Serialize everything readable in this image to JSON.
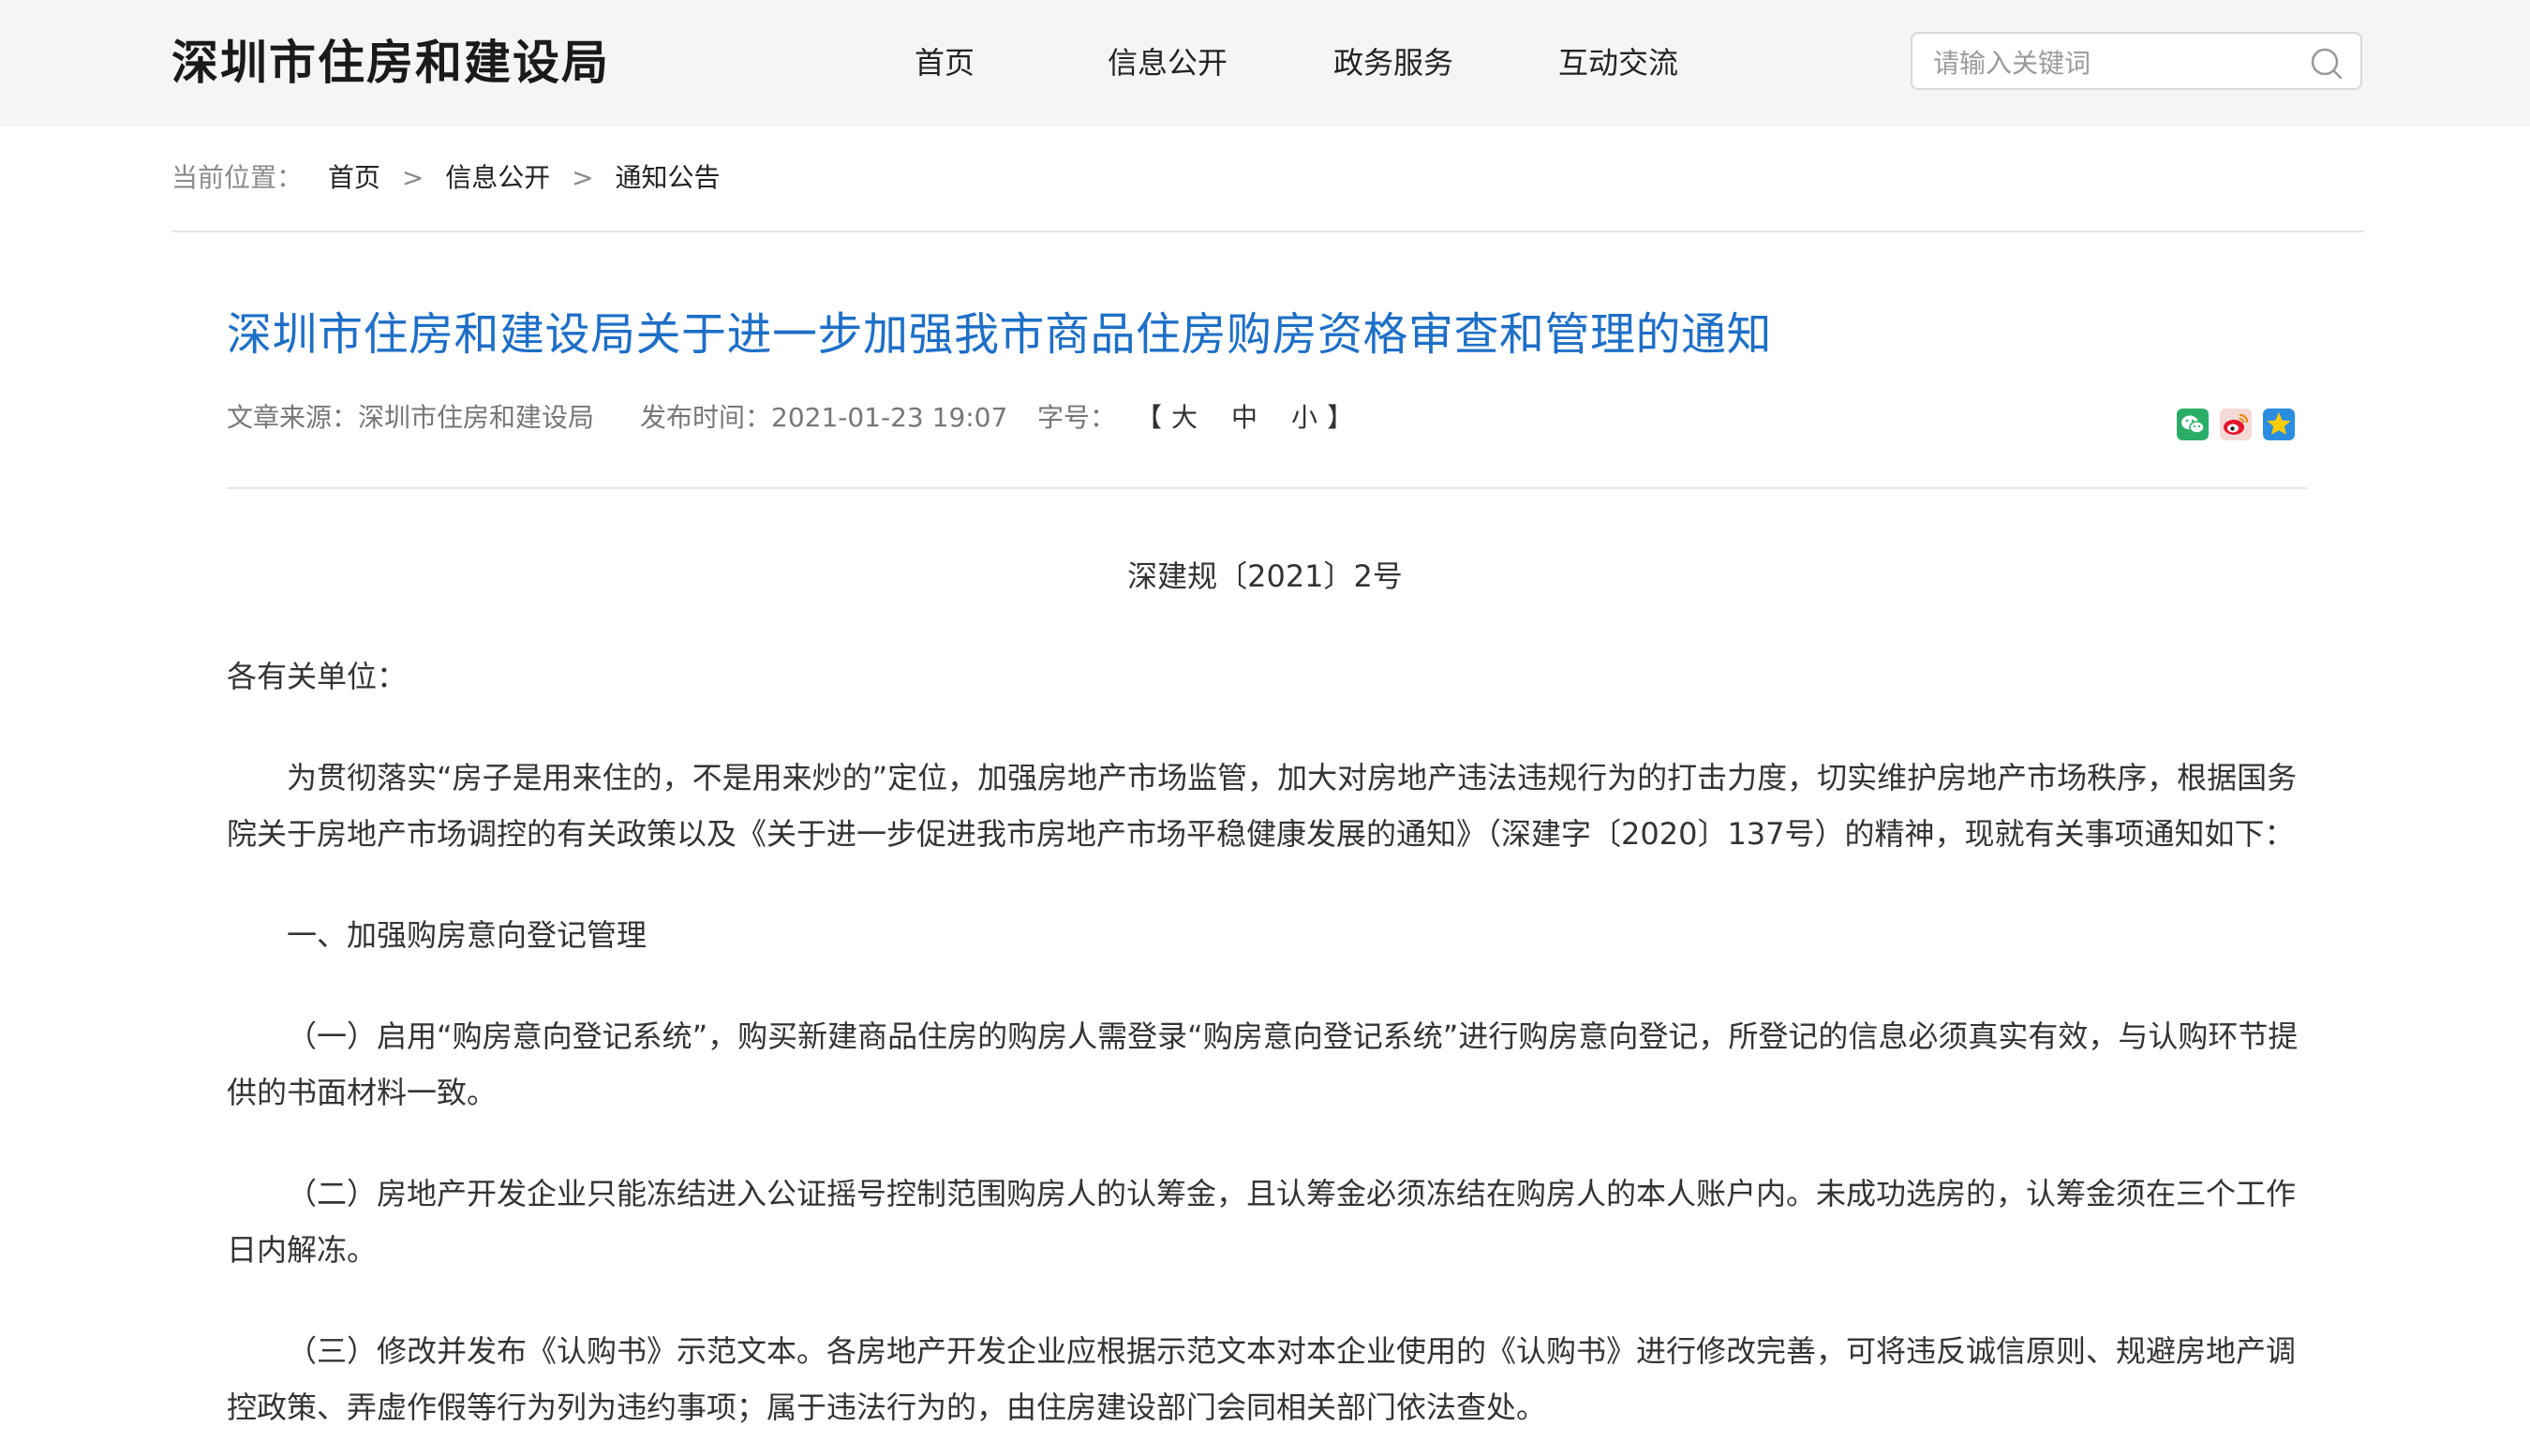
{
  "header": {
    "site_title": "深圳市住房和建设局",
    "nav": [
      "首页",
      "信息公开",
      "政务服务",
      "互动交流"
    ],
    "search": {
      "placeholder": "请输入关键词"
    }
  },
  "breadcrumb": {
    "label": "当前位置：",
    "items": [
      "首页",
      "信息公开",
      "通知公告"
    ],
    "separator": ">"
  },
  "article": {
    "title": "深圳市住房和建设局关于进一步加强我市商品住房购房资格审查和管理的通知",
    "source": "文章来源：深圳市住房和建设局",
    "publish_time": "发布时间：2021-01-23 19:07",
    "font_size_label": "字号：",
    "font_size": {
      "open": "【",
      "large": "大",
      "medium": "中",
      "small": "小",
      "close": "】"
    },
    "share_icons": [
      "wechat-icon",
      "weibo-icon",
      "qzone-icon"
    ],
    "doc_number": "深建规〔2021〕2号",
    "paragraphs": [
      "各有关单位：",
      "为贯彻落实“房子是用来住的，不是用来炒的”定位，加强房地产市场监管，加大对房地产违法违规行为的打击力度，切实维护房地产市场秩序，根据国务院关于房地产市场调控的有关政策以及《关于进一步促进我市房地产市场平稳健康发展的通知》（深建字〔2020〕137号）的精神，现就有关事项通知如下：",
      "一、加强购房意向登记管理",
      "（一）启用“购房意向登记系统”，购买新建商品住房的购房人需登录“购房意向登记系统”进行购房意向登记，所登记的信息必须真实有效，与认购环节提供的书面材料一致。",
      "（二）房地产开发企业只能冻结进入公证摇号控制范围购房人的认筹金，且认筹金必须冻结在购房人的本人账户内。未成功选房的，认筹金须在三个工作日内解冻。",
      "（三）修改并发布《认购书》示范文本。各房地产开发企业应根据示范文本对本企业使用的《认购书》进行修改完善，可将违反诚信原则、规避房地产调控政策、弄虚作假等行为列为违约事项；属于违法行为的，由住房建设部门会同相关部门依法查处。"
    ]
  },
  "colors": {
    "header_bg": "#f5f5f5",
    "title_blue": "#1e6fc7",
    "wechat_green": "#2aae67",
    "weibo_red": "#e6162d",
    "qzone_blue": "#2b8ddf"
  }
}
